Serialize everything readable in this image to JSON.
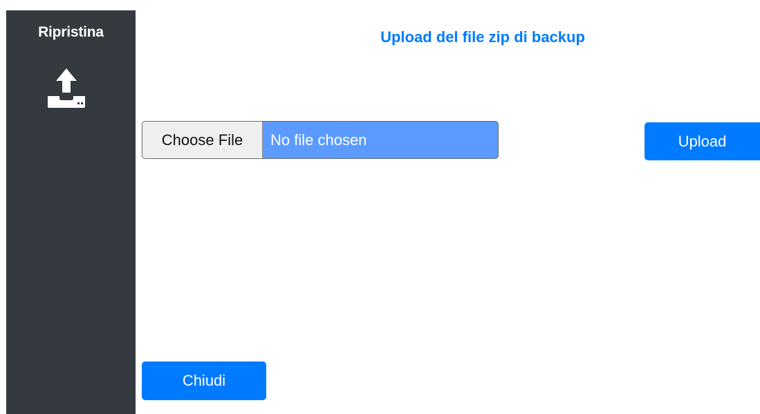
{
  "sidebar": {
    "title": "Ripristina",
    "icon": "upload-tray-icon",
    "background_color": "#343a40"
  },
  "header": {
    "title": "Upload del file zip di backup"
  },
  "file_input": {
    "button_label": "Choose File",
    "status_text": "No file chosen"
  },
  "actions": {
    "upload_label": "Upload",
    "close_label": "Chiudi"
  },
  "colors": {
    "accent": "#007bff",
    "file_input_fill": "#5b9bff",
    "sidebar": "#343a40"
  }
}
